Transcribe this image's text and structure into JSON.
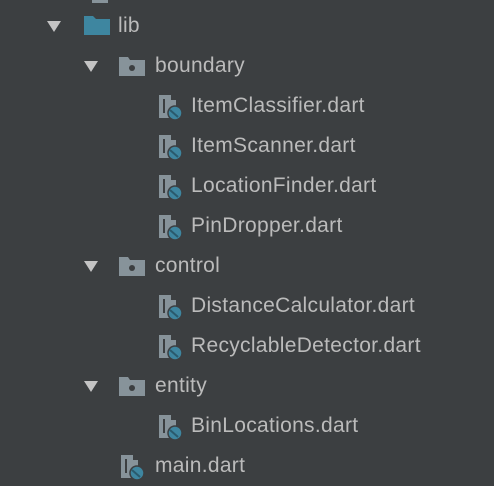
{
  "project_tree": {
    "lib": {
      "label": "lib",
      "expanded": true,
      "children": {
        "boundary": {
          "label": "boundary",
          "expanded": true,
          "files": [
            "ItemClassifier.dart",
            "ItemScanner.dart",
            "LocationFinder.dart",
            "PinDropper.dart"
          ]
        },
        "control": {
          "label": "control",
          "expanded": true,
          "files": [
            "DistanceCalculator.dart",
            "RecyclableDetector.dart"
          ]
        },
        "entity": {
          "label": "entity",
          "expanded": true,
          "files": [
            "BinLocations.dart"
          ]
        }
      },
      "root_files": [
        "main.dart"
      ]
    }
  },
  "colors": {
    "background": "#3c3f41",
    "text": "#bbbbbb",
    "folder_lib": "#3e86a0",
    "folder_package": "#87939a",
    "dart_badge": "#3e86a0",
    "arrow": "#c4c4c4"
  },
  "icons": {
    "lib_folder": "folder-icon",
    "package_folder": "package-folder-icon",
    "dart_file": "dart-file-icon",
    "expand_arrow": "chevron-down-icon"
  }
}
